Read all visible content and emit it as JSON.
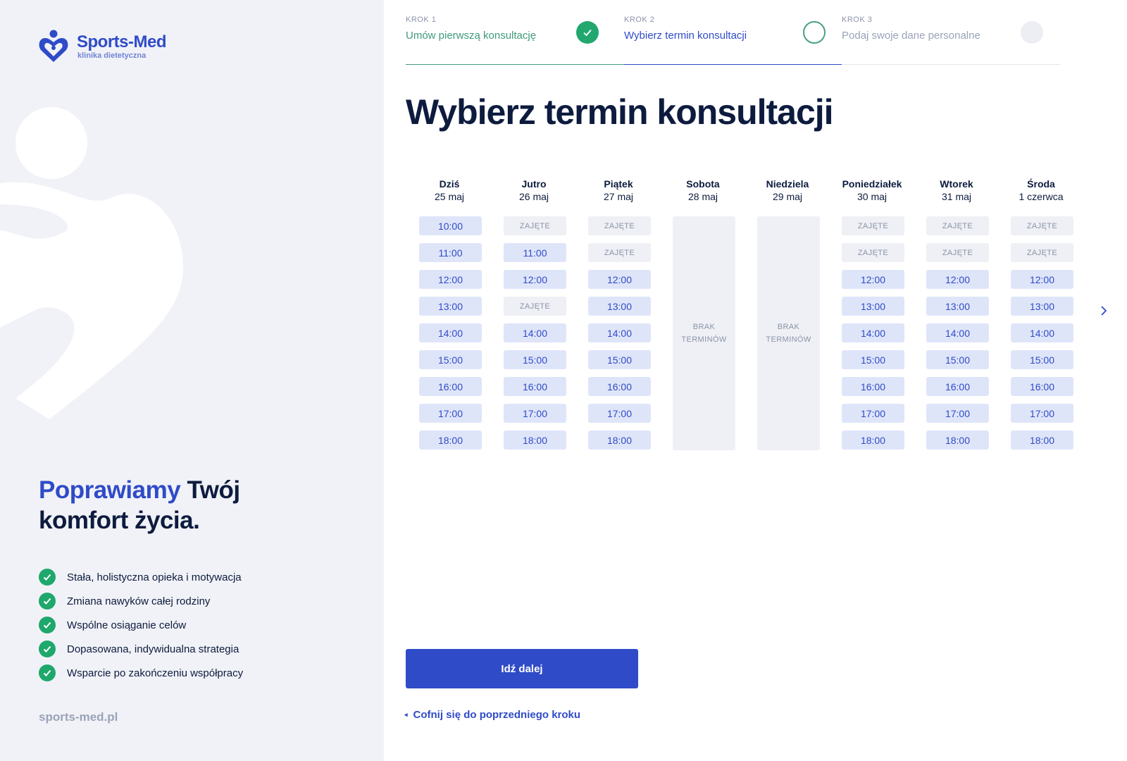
{
  "brand": {
    "name": "Sports-Med",
    "tagline": "klinika dietetyczna",
    "site_url": "sports-med.pl",
    "accent_color": "#2f4bc8",
    "success_color": "#1ea86b"
  },
  "sidebar": {
    "headline_accent": "Poprawiamy",
    "headline_rest_1": "Twój",
    "headline_rest_2": "komfort życia.",
    "benefits": [
      "Stała, holistyczna opieka i motywacja",
      "Zmiana nawyków całej rodziny",
      "Wspólne osiąganie celów",
      "Dopasowana, indywidualna strategia",
      "Wsparcie po zakończeniu współpracy"
    ]
  },
  "stepper": {
    "steps": [
      {
        "krok": "KROK 1",
        "label": "Umów pierwszą konsultację",
        "state": "done"
      },
      {
        "krok": "KROK 2",
        "label": "Wybierz termin konsultacji",
        "state": "active"
      },
      {
        "krok": "KROK 3",
        "label": "Podaj swoje dane personalne",
        "state": "pending"
      }
    ]
  },
  "main": {
    "title": "Wybierz termin konsultacji",
    "busy_label": "ZAJĘTE",
    "no_slots_line1": "BRAK",
    "no_slots_line2": "TERMINÓW",
    "next_button": "Idź dalej",
    "back_link": "Cofnij się do poprzedniego kroku",
    "back_caret": "◂"
  },
  "calendar": {
    "days": [
      {
        "name": "Dziś",
        "date": "25 maj",
        "slots": [
          {
            "time": "10:00",
            "status": "free"
          },
          {
            "time": "11:00",
            "status": "free"
          },
          {
            "time": "12:00",
            "status": "free"
          },
          {
            "time": "13:00",
            "status": "free"
          },
          {
            "time": "14:00",
            "status": "free"
          },
          {
            "time": "15:00",
            "status": "free"
          },
          {
            "time": "16:00",
            "status": "free"
          },
          {
            "time": "17:00",
            "status": "free"
          },
          {
            "time": "18:00",
            "status": "free"
          }
        ]
      },
      {
        "name": "Jutro",
        "date": "26 maj",
        "slots": [
          {
            "time": "10:00",
            "status": "busy"
          },
          {
            "time": "11:00",
            "status": "free"
          },
          {
            "time": "12:00",
            "status": "free"
          },
          {
            "time": "13:00",
            "status": "busy"
          },
          {
            "time": "14:00",
            "status": "free"
          },
          {
            "time": "15:00",
            "status": "free"
          },
          {
            "time": "16:00",
            "status": "free"
          },
          {
            "time": "17:00",
            "status": "free"
          },
          {
            "time": "18:00",
            "status": "free"
          }
        ]
      },
      {
        "name": "Piątek",
        "date": "27 maj",
        "slots": [
          {
            "time": "10:00",
            "status": "busy"
          },
          {
            "time": "11:00",
            "status": "busy"
          },
          {
            "time": "12:00",
            "status": "free"
          },
          {
            "time": "13:00",
            "status": "free"
          },
          {
            "time": "14:00",
            "status": "free"
          },
          {
            "time": "15:00",
            "status": "free"
          },
          {
            "time": "16:00",
            "status": "free"
          },
          {
            "time": "17:00",
            "status": "free"
          },
          {
            "time": "18:00",
            "status": "free"
          }
        ]
      },
      {
        "name": "Sobota",
        "date": "28 maj",
        "slots": []
      },
      {
        "name": "Niedziela",
        "date": "29 maj",
        "slots": []
      },
      {
        "name": "Poniedziałek",
        "date": "30 maj",
        "slots": [
          {
            "time": "10:00",
            "status": "busy"
          },
          {
            "time": "11:00",
            "status": "busy"
          },
          {
            "time": "12:00",
            "status": "free"
          },
          {
            "time": "13:00",
            "status": "free"
          },
          {
            "time": "14:00",
            "status": "free"
          },
          {
            "time": "15:00",
            "status": "free"
          },
          {
            "time": "16:00",
            "status": "free"
          },
          {
            "time": "17:00",
            "status": "free"
          },
          {
            "time": "18:00",
            "status": "free"
          }
        ]
      },
      {
        "name": "Wtorek",
        "date": "31 maj",
        "slots": [
          {
            "time": "10:00",
            "status": "busy"
          },
          {
            "time": "11:00",
            "status": "busy"
          },
          {
            "time": "12:00",
            "status": "free"
          },
          {
            "time": "13:00",
            "status": "free"
          },
          {
            "time": "14:00",
            "status": "free"
          },
          {
            "time": "15:00",
            "status": "free"
          },
          {
            "time": "16:00",
            "status": "free"
          },
          {
            "time": "17:00",
            "status": "free"
          },
          {
            "time": "18:00",
            "status": "free"
          }
        ]
      },
      {
        "name": "Środa",
        "date": "1 czerwca",
        "slots": [
          {
            "time": "10:00",
            "status": "busy"
          },
          {
            "time": "11:00",
            "status": "busy"
          },
          {
            "time": "12:00",
            "status": "free"
          },
          {
            "time": "13:00",
            "status": "free"
          },
          {
            "time": "14:00",
            "status": "free"
          },
          {
            "time": "15:00",
            "status": "free"
          },
          {
            "time": "16:00",
            "status": "free"
          },
          {
            "time": "17:00",
            "status": "free"
          },
          {
            "time": "18:00",
            "status": "free"
          }
        ]
      }
    ]
  }
}
